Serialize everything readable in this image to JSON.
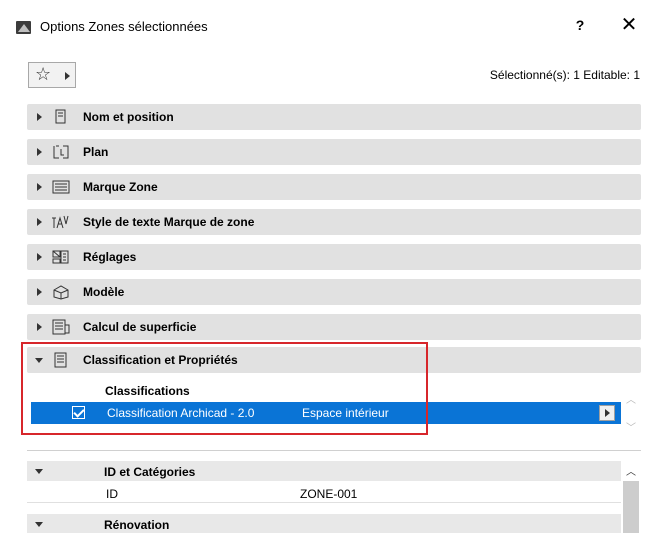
{
  "window": {
    "title": "Options Zones sélectionnées",
    "help_label": "?",
    "close_label": "✕"
  },
  "toolbar": {
    "favorites_icon": "star-icon",
    "selection_status": "Sélectionné(s): 1 Editable: 1"
  },
  "panels": [
    {
      "label": "Nom et position",
      "icon": "name-position-icon",
      "expanded": false
    },
    {
      "label": "Plan",
      "icon": "floor-plan-icon",
      "expanded": false
    },
    {
      "label": "Marque Zone",
      "icon": "zone-stamp-icon",
      "expanded": false
    },
    {
      "label": "Style de texte Marque de zone",
      "icon": "text-style-icon",
      "expanded": false
    },
    {
      "label": "Réglages",
      "icon": "settings-icon",
      "expanded": false
    },
    {
      "label": "Modèle",
      "icon": "model-icon",
      "expanded": false
    },
    {
      "label": "Calcul de superficie",
      "icon": "area-calc-icon",
      "expanded": false
    },
    {
      "label": "Classification et Propriétés",
      "icon": "classification-icon",
      "expanded": true
    }
  ],
  "classifications": {
    "header": "Classifications",
    "row": {
      "checked": true,
      "system": "Classification Archicad - 2.0",
      "value": "Espace intérieur"
    }
  },
  "properties": {
    "groups": [
      {
        "label": "ID et Catégories",
        "items": [
          {
            "name": "ID",
            "value": "ZONE-001"
          }
        ]
      },
      {
        "label": "Rénovation",
        "items": []
      }
    ]
  },
  "colors": {
    "selection": "#0a74d6",
    "highlight_border": "#d7262b",
    "panel_bg": "#e1e1e1"
  }
}
